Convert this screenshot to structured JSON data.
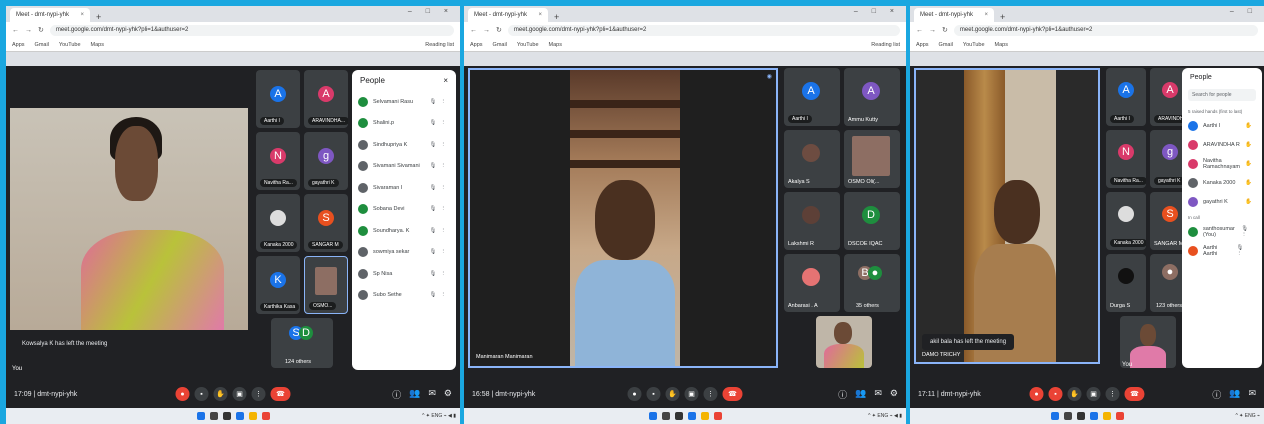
{
  "browser": {
    "tab_title": "Meet - dmt-nypi-yhk",
    "url": "meet.google.com/dmt-nypi-yhk?pli=1&authuser=2",
    "bookmarks": [
      "Apps",
      "Gmail",
      "YouTube",
      "Maps"
    ],
    "reading_list": "Reading list"
  },
  "panels": [
    {
      "time_code": "17:09 | dmt-nypi-yhk",
      "toast": "Kowsalya K has left the meeting",
      "self_label": "You",
      "tiles": [
        {
          "letter": "A",
          "name": "Aarthi I",
          "color": "#1a73e8"
        },
        {
          "letter": "A",
          "name": "ARAVINDHA...",
          "color": "#d93a6a"
        },
        {
          "letter": "N",
          "name": "Navitha Ra...",
          "color": "#d93a6a"
        },
        {
          "letter": "g",
          "name": "gayathri K",
          "color": "#7e57c2"
        },
        {
          "letter": "",
          "name": "Kanaka 2000",
          "color": "#5f6368"
        },
        {
          "letter": "S",
          "name": "SANGAR M",
          "color": "#e8501f"
        },
        {
          "letter": "K",
          "name": "Karthika Kasa",
          "color": "#1a73e8"
        },
        {
          "letter": "",
          "name": "OSMO...",
          "color": "#8d6e63"
        }
      ],
      "others": "124 others",
      "people_title": "People",
      "people": [
        {
          "name": "Selvamani Rasu",
          "color": "#1e8e3e"
        },
        {
          "name": "Shalini.p",
          "color": "#1e8e3e"
        },
        {
          "name": "Sindhupriya K",
          "color": "#5f6368"
        },
        {
          "name": "Sivamani Sivamani",
          "color": "#5f6368"
        },
        {
          "name": "Sivaraman I",
          "color": "#5f6368"
        },
        {
          "name": "Sobana Devi",
          "color": "#1e8e3e"
        },
        {
          "name": "Soundharya. K",
          "color": "#1e8e3e"
        },
        {
          "name": "sowmiya sekar",
          "color": "#5f6368"
        },
        {
          "name": "Sp Nisa",
          "color": "#5f6368"
        },
        {
          "name": "Subo Sethe",
          "color": "#5f6368"
        }
      ]
    },
    {
      "time_code": "16:58 | dmt-nypi-yhk",
      "main_name": "Manimaran Manimaran",
      "tiles": [
        {
          "letter": "A",
          "name": "Aarthi I",
          "color": "#1a73e8"
        },
        {
          "letter": "A",
          "name": "Ammu Kutty",
          "color": "#7e57c2"
        },
        {
          "letter": "",
          "name": "Akalya S",
          "color": "#6d4c41"
        },
        {
          "letter": "",
          "name": "OSMO Oli(...",
          "color": "#8d6e63"
        },
        {
          "letter": "",
          "name": "Lakshmi R",
          "color": "#5d4037"
        },
        {
          "letter": "D",
          "name": "DSCOE IQAC",
          "color": "#1e8e3e"
        },
        {
          "letter": "",
          "name": "Anbarasi . A",
          "color": "#e57373"
        }
      ],
      "others": "35 others"
    },
    {
      "time_code": "17:11 | dmt-nypi-yhk",
      "toast": "akil bala has left the meeting",
      "main_name": "DAMO TRICHY",
      "self_label": "You",
      "tiles": [
        {
          "letter": "A",
          "name": "Aarthi I",
          "color": "#1a73e8"
        },
        {
          "letter": "A",
          "name": "ARAVINDHA...",
          "color": "#d93a6a"
        },
        {
          "letter": "N",
          "name": "Navitha Ra...",
          "color": "#d93a6a"
        },
        {
          "letter": "g",
          "name": "gayathri K",
          "color": "#7e57c2"
        },
        {
          "letter": "",
          "name": "Kanaka 2000",
          "color": "#5f6368"
        },
        {
          "letter": "S",
          "name": "SANGAR M",
          "color": "#e8501f"
        },
        {
          "letter": "",
          "name": "Durga S",
          "color": "#5f6368"
        }
      ],
      "others": "123 others",
      "people_title": "People",
      "search_placeholder": "Search for people",
      "raised_hands": "5 raised hands (first to last)",
      "raised": [
        {
          "name": "Aarthi I",
          "color": "#1a73e8"
        },
        {
          "name": "ARAVINDHA R",
          "color": "#d93a6a"
        },
        {
          "name": "Navitha Ramachnayam",
          "color": "#d93a6a"
        },
        {
          "name": "Kanaka 2000",
          "color": "#5f6368"
        },
        {
          "name": "gayathri K",
          "color": "#7e57c2"
        }
      ],
      "in_call": "In call",
      "incall": [
        {
          "name": "santhosumar (You)",
          "color": "#1e8e3e"
        },
        {
          "name": "Aarthi Aarthi",
          "color": "#e8501f"
        }
      ]
    }
  ]
}
